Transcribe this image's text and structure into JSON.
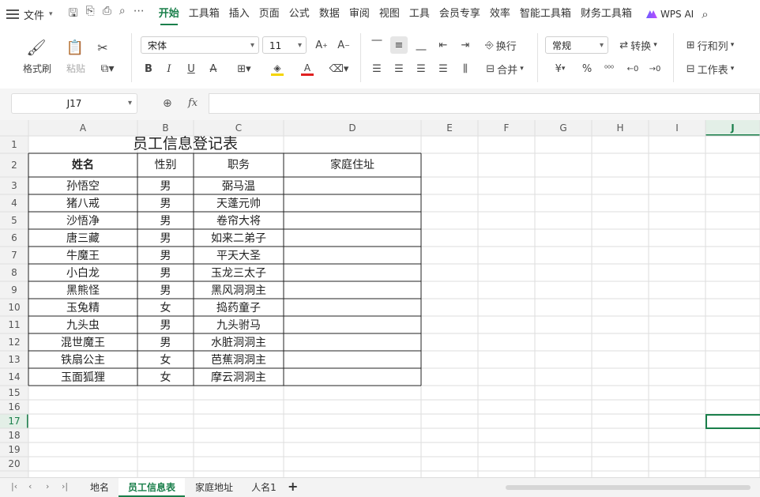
{
  "menubar": {
    "file_label": "文件",
    "tabs": [
      "开始",
      "工具箱",
      "插入",
      "页面",
      "公式",
      "数据",
      "审阅",
      "视图",
      "工具",
      "会员专享",
      "效率",
      "智能工具箱",
      "财务工具箱"
    ],
    "ai_label": "WPS AI"
  },
  "ribbon": {
    "format_painter": "格式刷",
    "paste": "粘贴",
    "font_name": "宋体",
    "font_size": "11",
    "wrap": "换行",
    "merge": "合并",
    "number_format": "常规",
    "convert": "转换",
    "rows_cols": "行和列",
    "worksheet": "工作表",
    "currency_symbol": "¥",
    "percent_symbol": "%",
    "fill_color": "#f5d400",
    "font_color": "#e02020"
  },
  "formula_bar": {
    "cell_ref": "J17",
    "fx_label": "fx",
    "formula": ""
  },
  "grid": {
    "columns": [
      "A",
      "B",
      "C",
      "D",
      "E",
      "F",
      "G",
      "H",
      "I",
      "J"
    ],
    "rows": [
      "1",
      "2",
      "3",
      "4",
      "5",
      "6",
      "7",
      "8",
      "9",
      "10",
      "11",
      "12",
      "13",
      "14",
      "15",
      "16",
      "17",
      "18",
      "19",
      "20"
    ],
    "selected_cell": "J17"
  },
  "table": {
    "title": "员工信息登记表",
    "headers": [
      "姓名",
      "性别",
      "职务",
      "家庭住址"
    ],
    "rows": [
      [
        "孙悟空",
        "男",
        "弼马温",
        ""
      ],
      [
        "猪八戒",
        "男",
        "天蓬元帅",
        ""
      ],
      [
        "沙悟净",
        "男",
        "卷帘大将",
        ""
      ],
      [
        "唐三藏",
        "男",
        "如来二弟子",
        ""
      ],
      [
        "牛魔王",
        "男",
        "平天大圣",
        ""
      ],
      [
        "小白龙",
        "男",
        "玉龙三太子",
        ""
      ],
      [
        "黑熊怪",
        "男",
        "黑风洞洞主",
        ""
      ],
      [
        "玉兔精",
        "女",
        "捣药童子",
        ""
      ],
      [
        "九头虫",
        "男",
        "九头驸马",
        ""
      ],
      [
        "混世魔王",
        "男",
        "水脏洞洞主",
        ""
      ],
      [
        "铁扇公主",
        "女",
        "芭蕉洞洞主",
        ""
      ],
      [
        "玉面狐狸",
        "女",
        "摩云洞洞主",
        ""
      ]
    ]
  },
  "sheet_tabs": [
    "地名",
    "员工信息表",
    "家庭地址",
    "人名1"
  ],
  "active_sheet": "员工信息表"
}
